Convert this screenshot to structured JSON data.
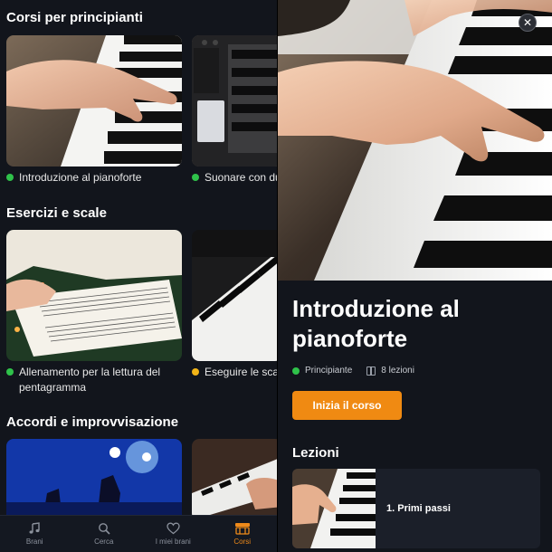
{
  "left": {
    "sections": [
      {
        "title": "Corsi per principianti",
        "cards": [
          {
            "caption": "Introduzione al pianoforte",
            "status": "green"
          },
          {
            "caption": "Suonare con du",
            "status": "green"
          }
        ]
      },
      {
        "title": "Esercizi e scale",
        "cards": [
          {
            "caption": "Allenamento per la lettura del pentagramma",
            "status": "green"
          },
          {
            "caption": "Eseguire le scal",
            "status": "yellow"
          }
        ]
      },
      {
        "title": "Accordi e improvvisazione"
      }
    ]
  },
  "tabbar": {
    "tabs": [
      {
        "label": "Brani",
        "icon": "music-note-icon"
      },
      {
        "label": "Cerca",
        "icon": "search-icon"
      },
      {
        "label": "I miei brani",
        "icon": "heart-icon"
      },
      {
        "label": "Corsi",
        "icon": "courses-icon",
        "active": true
      }
    ],
    "active_color": "#ee8a1a"
  },
  "detail": {
    "close_symbol": "✕",
    "title": "Introduzione al pianoforte",
    "level": "Principiante",
    "lessons_count": "8 lezioni",
    "cta": "Inizia il corso",
    "lessons_heading": "Lezioni",
    "lessons": [
      {
        "label": "1. Primi passi"
      }
    ]
  },
  "colors": {
    "accent": "#f08a12",
    "green": "#2fc24a",
    "yellow": "#f2b417",
    "background": "#12151c"
  }
}
